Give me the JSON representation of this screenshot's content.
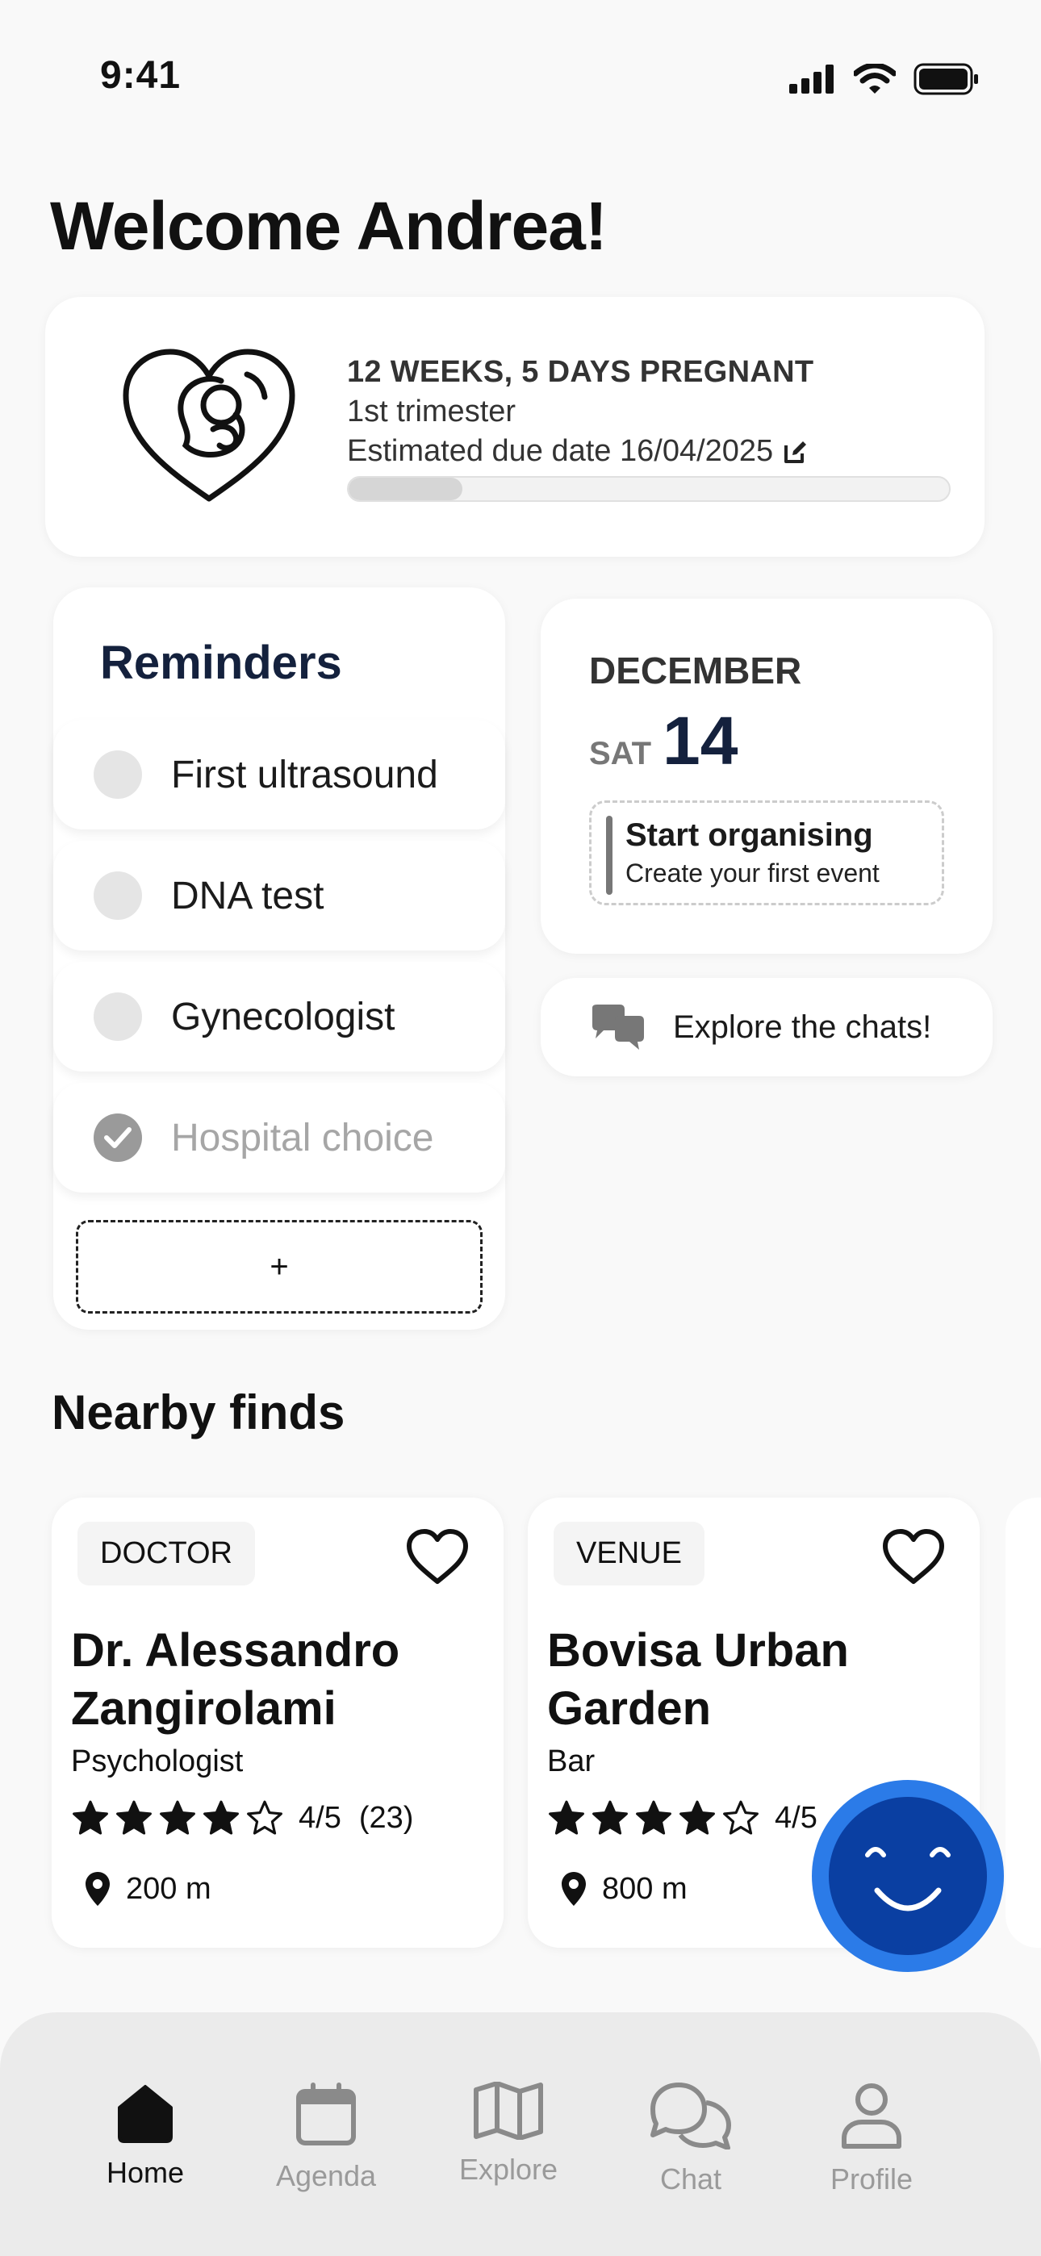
{
  "status_bar": {
    "time": "9:41"
  },
  "greeting": "Welcome Andrea!",
  "pregnancy": {
    "weeks": "12 WEEKS, 5 DAYS PREGNANT",
    "trimester": "1st trimester",
    "due_date": "Estimated due date 16/04/2025",
    "progress_fraction": 0.19
  },
  "reminders": {
    "title": "Reminders",
    "items": [
      {
        "label": "First ultrasound",
        "done": false
      },
      {
        "label": "DNA test",
        "done": false
      },
      {
        "label": "Gynecologist",
        "done": false
      },
      {
        "label": "Hospital choice",
        "done": true
      }
    ],
    "add_label": "+"
  },
  "calendar": {
    "month": "DECEMBER",
    "weekday": "SAT",
    "day": "14",
    "event_title": "Start organising",
    "event_sub": "Create your first event"
  },
  "chats_card": {
    "label": "Explore  the chats!"
  },
  "nearby": {
    "title": "Nearby finds",
    "places": [
      {
        "tag": "DOCTOR",
        "name": "Dr. Alessandro Zangirolami",
        "type": "Psychologist",
        "rating": 4,
        "rating_text": "4/5",
        "reviews": "(23)",
        "distance": "200 m"
      },
      {
        "tag": "VENUE",
        "name": "Bovisa Urban Garden",
        "type": "Bar",
        "rating": 4,
        "rating_text": "4/5",
        "reviews": "",
        "distance": "800 m"
      }
    ]
  },
  "nav": {
    "items": [
      {
        "label": "Home",
        "icon": "home-icon",
        "active": true
      },
      {
        "label": "Agenda",
        "icon": "calendar-icon",
        "active": false
      },
      {
        "label": "Explore",
        "icon": "map-icon",
        "active": false
      },
      {
        "label": "Chat",
        "icon": "chat-icon",
        "active": false
      },
      {
        "label": "Profile",
        "icon": "user-icon",
        "active": false
      }
    ]
  },
  "colors": {
    "accent": "#14213d",
    "fab_outer": "#2b7be8",
    "fab_inner": "#0a3fa2",
    "nav_bg": "#ebebeb"
  }
}
